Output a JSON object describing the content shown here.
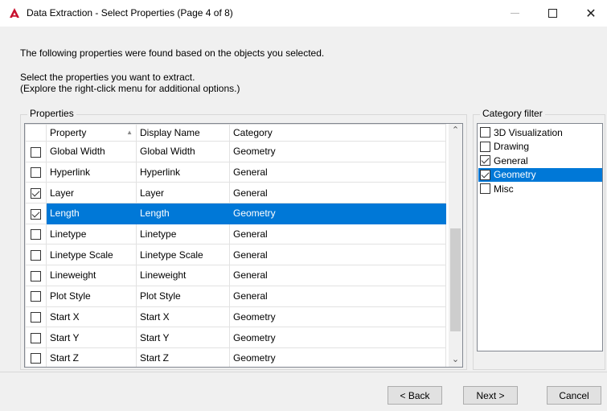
{
  "window": {
    "title": "Data Extraction - Select Properties (Page 4 of 8)",
    "close_glyph": "✕",
    "accent_color": "#0078d7",
    "app_icon_color": "#c8102e"
  },
  "intro_text": "The following properties were found based on the objects you selected.",
  "instructions": {
    "line1": "Select the properties you want to extract.",
    "line2": "(Explore the right-click menu for additional options.)"
  },
  "properties_panel": {
    "legend": "Properties",
    "columns": [
      "Property",
      "Display Name",
      "Category"
    ],
    "sort_indicator": "▲",
    "rows": [
      {
        "property": "Global Width",
        "display_name": "Global Width",
        "category": "Geometry",
        "checked": false,
        "selected": false
      },
      {
        "property": "Hyperlink",
        "display_name": "Hyperlink",
        "category": "General",
        "checked": false,
        "selected": false
      },
      {
        "property": "Layer",
        "display_name": "Layer",
        "category": "General",
        "checked": true,
        "selected": false
      },
      {
        "property": "Length",
        "display_name": "Length",
        "category": "Geometry",
        "checked": true,
        "selected": true
      },
      {
        "property": "Linetype",
        "display_name": "Linetype",
        "category": "General",
        "checked": false,
        "selected": false
      },
      {
        "property": "Linetype Scale",
        "display_name": "Linetype Scale",
        "category": "General",
        "checked": false,
        "selected": false
      },
      {
        "property": "Lineweight",
        "display_name": "Lineweight",
        "category": "General",
        "checked": false,
        "selected": false
      },
      {
        "property": "Plot Style",
        "display_name": "Plot Style",
        "category": "General",
        "checked": false,
        "selected": false
      },
      {
        "property": "Start X",
        "display_name": "Start X",
        "category": "Geometry",
        "checked": false,
        "selected": false
      },
      {
        "property": "Start Y",
        "display_name": "Start Y",
        "category": "Geometry",
        "checked": false,
        "selected": false
      },
      {
        "property": "Start Z",
        "display_name": "Start Z",
        "category": "Geometry",
        "checked": false,
        "selected": false
      }
    ]
  },
  "category_filter": {
    "legend": "Category filter",
    "items": [
      {
        "label": "3D Visualization",
        "checked": false,
        "selected": false
      },
      {
        "label": "Drawing",
        "checked": false,
        "selected": false
      },
      {
        "label": "General",
        "checked": true,
        "selected": false
      },
      {
        "label": "Geometry",
        "checked": true,
        "selected": true
      },
      {
        "label": "Misc",
        "checked": false,
        "selected": false
      }
    ]
  },
  "buttons": {
    "back": "< Back",
    "next": "Next >",
    "cancel": "Cancel"
  }
}
